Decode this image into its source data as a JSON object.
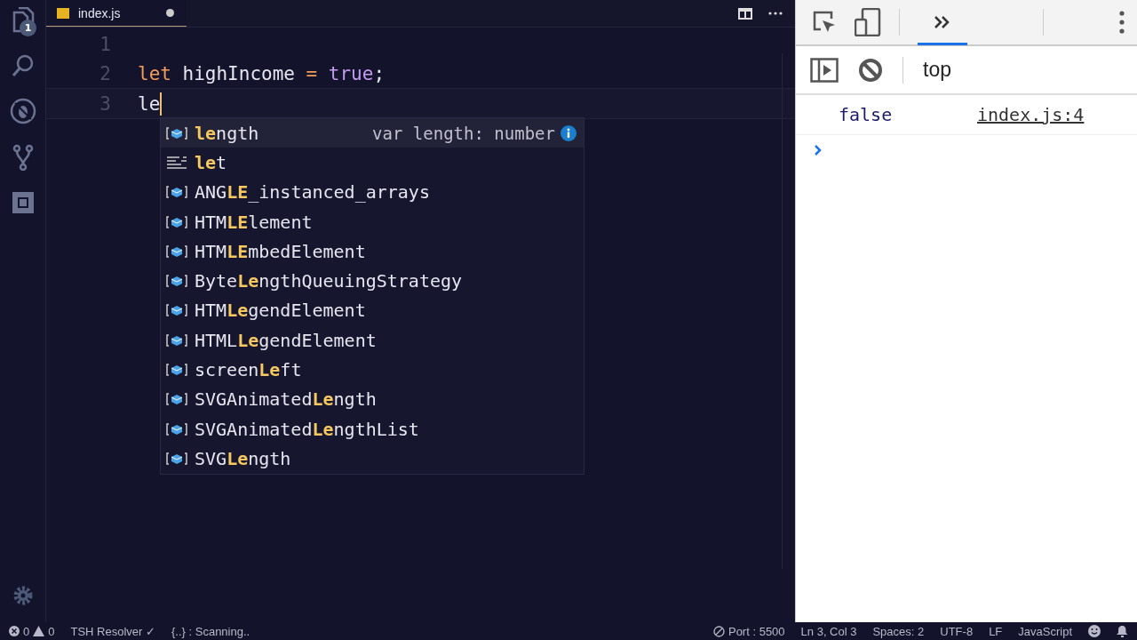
{
  "activity_bar": {
    "badge": "1"
  },
  "tab": {
    "label": "index.js",
    "dirty": true
  },
  "editor": {
    "lines": [
      {
        "number": "1"
      },
      {
        "number": "2",
        "tokens": [
          {
            "kind": "keyword",
            "text": "let"
          },
          {
            "kind": "plain",
            "text": "highIncome"
          },
          {
            "kind": "operator",
            "text": "="
          },
          {
            "kind": "constant",
            "text": "true"
          },
          {
            "kind": "punct",
            "text": ";"
          }
        ]
      },
      {
        "number": "3",
        "tokens": [
          {
            "kind": "plain",
            "text": "le"
          }
        ],
        "cursor": true
      }
    ]
  },
  "suggestions": [
    {
      "kind": "property",
      "label": "**le**ngth",
      "detail": "var length: number",
      "selected": true
    },
    {
      "kind": "keyword",
      "label": "**le**t",
      "selected": false
    },
    {
      "kind": "property",
      "label": "ANG**LE**_instanced_arrays",
      "selected": false
    },
    {
      "kind": "property",
      "label": "HTM**LE**lement",
      "selected": false
    },
    {
      "kind": "property",
      "label": "HTM**LE**mbedElement",
      "selected": false
    },
    {
      "kind": "property",
      "label": "Byte**Le**ngthQueuingStrategy",
      "selected": false
    },
    {
      "kind": "property",
      "label": "HTM**Le**gendElement",
      "selected": false
    },
    {
      "kind": "property",
      "label": "HTML**Le**gendElement",
      "selected": false
    },
    {
      "kind": "property",
      "label": "screen**Le**ft",
      "selected": false
    },
    {
      "kind": "property",
      "label": "SVGAnimated**Le**ngth",
      "selected": false
    },
    {
      "kind": "property",
      "label": "SVGAnimated**Le**ngthList",
      "selected": false
    },
    {
      "kind": "property",
      "label": "SVG**Le**ngth",
      "selected": false
    }
  ],
  "status_bar": {
    "errors": "0",
    "warnings": "0",
    "left": [
      "TSH Resolver ✓",
      "{..} : Scanning.."
    ],
    "port": "Port : 5500",
    "right": [
      "Ln 3, Col 3",
      "Spaces: 2",
      "UTF-8",
      "LF",
      "JavaScript"
    ]
  },
  "devtools": {
    "context": "top",
    "messages": [
      {
        "text": "false",
        "source": "index.js:4"
      }
    ]
  }
}
